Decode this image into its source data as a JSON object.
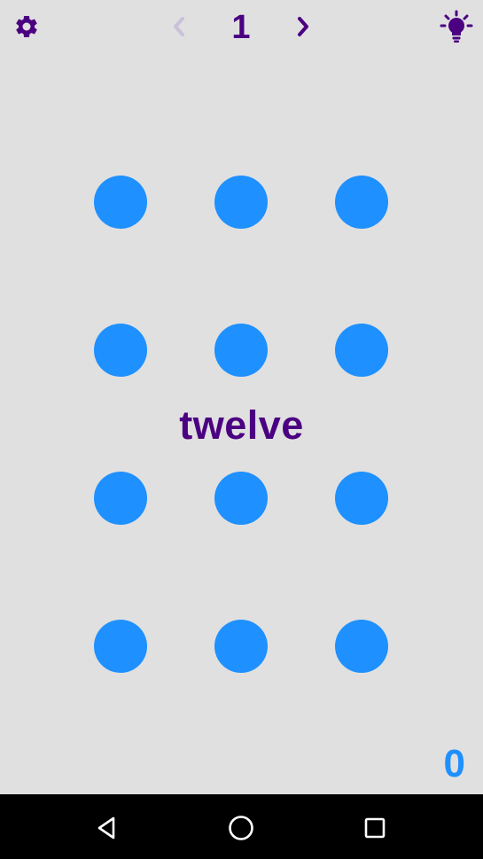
{
  "header": {
    "level_number": "1",
    "settings_icon": "gear-icon",
    "prev_icon": "chevron-left-icon",
    "next_icon": "chevron-right-icon",
    "hint_icon": "lightbulb-icon"
  },
  "puzzle": {
    "word": "twelve",
    "dot_count": 12
  },
  "footer": {
    "score": "0"
  },
  "system_nav": {
    "back_icon": "back-triangle-icon",
    "home_icon": "home-circle-icon",
    "recent_icon": "recent-apps-square-icon"
  },
  "colors": {
    "background": "#e0e0e0",
    "accent_purple": "#4b0082",
    "prev_disabled": "#c9c0da",
    "dot_blue": "#1e90ff",
    "nav_bar": "#000000"
  }
}
